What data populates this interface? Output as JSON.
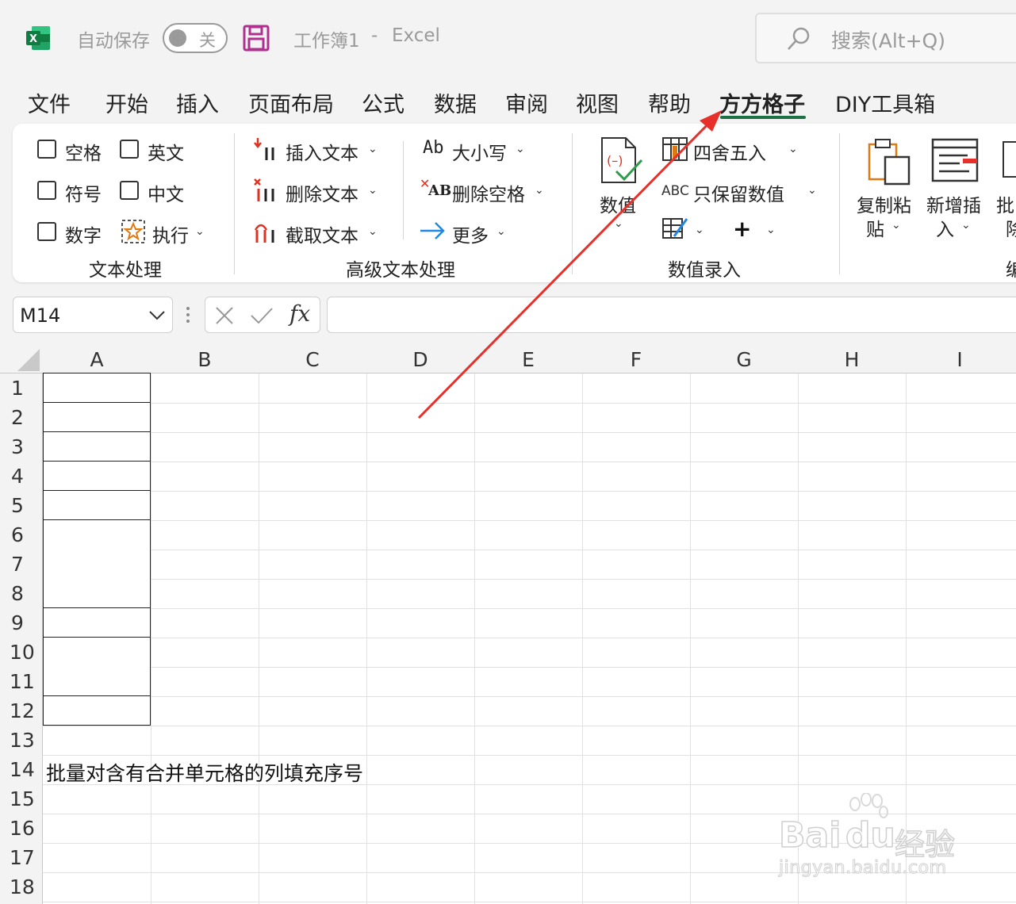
{
  "titlebar": {
    "autosave_label": "自动保存",
    "autosave_state": "关",
    "workbook_title": "工作簿1",
    "separator": "-",
    "app_name": "Excel",
    "search_placeholder": "搜索(Alt+Q)"
  },
  "tabs": [
    {
      "label": "文件"
    },
    {
      "label": "开始"
    },
    {
      "label": "插入"
    },
    {
      "label": "页面布局"
    },
    {
      "label": "公式"
    },
    {
      "label": "数据"
    },
    {
      "label": "审阅"
    },
    {
      "label": "视图"
    },
    {
      "label": "帮助"
    },
    {
      "label": "方方格子"
    },
    {
      "label": "DIY工具箱"
    }
  ],
  "active_tab": "方方格子",
  "ribbon": {
    "text_group": {
      "label": "文本处理",
      "checkboxes": [
        {
          "label": "空格"
        },
        {
          "label": "英文"
        },
        {
          "label": "符号"
        },
        {
          "label": "中文"
        },
        {
          "label": "数字"
        }
      ],
      "execute": "执行"
    },
    "adv_group": {
      "label": "高级文本处理",
      "insert_text": "插入文本",
      "delete_text": "删除文本",
      "extract_text": "截取文本",
      "case": "大小写",
      "case_icon": "Ab",
      "delete_space": "删除空格",
      "delete_space_icon": "AB",
      "more": "更多"
    },
    "num_group": {
      "label": "数值录入",
      "numeric": "数值",
      "round": "四舍五入",
      "keep_numeric": "只保留数值",
      "keep_numeric_icon": "ABC"
    },
    "edit_group": {
      "copy_paste": [
        "复制粘",
        "贴"
      ],
      "new_insert": [
        "新增插",
        "入"
      ],
      "batch": [
        "批",
        "除"
      ],
      "label_partial": "编"
    }
  },
  "formula_bar": {
    "name_box": "M14",
    "fx": "fx",
    "formula": ""
  },
  "sheet": {
    "columns": [
      "A",
      "B",
      "C",
      "D",
      "E",
      "F",
      "G",
      "H",
      "I"
    ],
    "rows": [
      "1",
      "2",
      "3",
      "4",
      "5",
      "6",
      "7",
      "8",
      "9",
      "10",
      "11",
      "12",
      "13",
      "14",
      "15",
      "16",
      "17",
      "18"
    ],
    "cell_A14": "批量对含有合并单元格的列填充序号"
  },
  "watermark": {
    "brand": "Bai",
    "brand2": "du",
    "suffix": "经验",
    "url": "jingyan.baidu.com"
  },
  "colors": {
    "excel_green": "#1e7145",
    "arrow_red": "#e8302a",
    "accent_purple": "#b0308f"
  }
}
